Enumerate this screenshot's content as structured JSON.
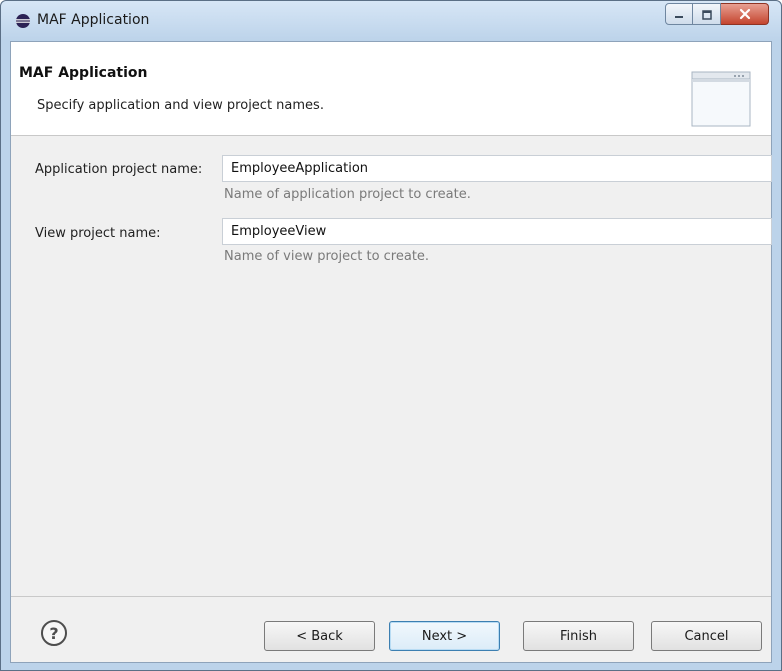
{
  "window": {
    "title": "MAF Application"
  },
  "header": {
    "title": "MAF Application",
    "description": "Specify application and view project names."
  },
  "form": {
    "application_project": {
      "label": "Application project name:",
      "value": "EmployeeApplication",
      "hint": "Name of application project to create."
    },
    "view_project": {
      "label": "View project name:",
      "value": "EmployeeView",
      "hint": "Name of view project to create."
    }
  },
  "footer": {
    "help_glyph": "?",
    "back_label": "< Back",
    "next_label": "Next >",
    "finish_label": "Finish",
    "cancel_label": "Cancel"
  },
  "colors": {
    "title_bar": "#bcd3ea",
    "close_button": "#c4452f",
    "default_button_border": "#3c7fb1",
    "hint_text": "#7a7a7a"
  },
  "icons": {
    "window_icon": "eclipse-icon",
    "header_graphic": "window-wizard-icon",
    "help": "help-icon"
  }
}
